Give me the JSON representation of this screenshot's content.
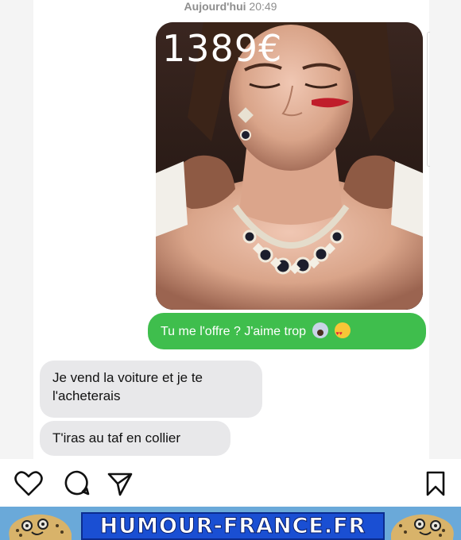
{
  "conversation": {
    "timestamp_day": "Aujourd'hui",
    "timestamp_time": "20:49",
    "photo_price": "1389€",
    "outgoing_text": "Tu me l'offre ? J'aime trop",
    "outgoing_emojis": [
      "face-screaming-in-fear",
      "smiling-face-with-heart-eyes"
    ],
    "incoming_1_line1": "Je vend la voiture et je te",
    "incoming_1_line2": "l'acheterais",
    "incoming_2": "T'iras au taf en collier"
  },
  "actions": {
    "icons": [
      "heart-icon",
      "comment-icon",
      "send-icon",
      "bookmark-icon"
    ]
  },
  "banner": {
    "text": "HUMOUR-FRANCE.FR",
    "box_color": "#1a4fd3",
    "bar_color": "#6aa9d9"
  },
  "colors": {
    "outgoing_bubble": "#3fbe4d",
    "incoming_bubble": "#e8e8ea"
  }
}
